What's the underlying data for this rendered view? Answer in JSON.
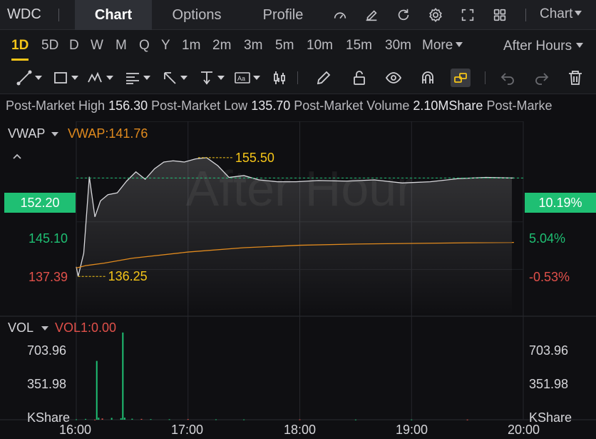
{
  "header": {
    "ticker": "WDC",
    "tabs": [
      "Chart",
      "Options",
      "Profile"
    ],
    "active_tab": "Chart",
    "icons": [
      "speedometer-icon",
      "edit-icon",
      "refresh-icon",
      "gear-icon",
      "fullscreen-icon",
      "grid-icon"
    ],
    "chart_menu": "Chart"
  },
  "timeframes": {
    "items": [
      "1D",
      "5D",
      "D",
      "W",
      "M",
      "Q",
      "Y",
      "1m",
      "2m",
      "3m",
      "5m",
      "10m",
      "15m",
      "30m",
      "More"
    ],
    "active": "1D",
    "session": "After Hours"
  },
  "draw_tools": [
    "line-tool-icon",
    "rectangle-tool-icon",
    "pattern-tool-icon",
    "fib-tool-icon",
    "arrow-tool-icon",
    "price-range-icon",
    "text-tool-icon",
    "candle-tool-icon",
    "pencil-icon",
    "unlock-icon",
    "eye-icon",
    "magnet-icon",
    "link-icon",
    "undo-icon",
    "redo-icon",
    "trash-icon"
  ],
  "info_strip": {
    "items": [
      {
        "label": "Post-Market High",
        "value": "156.30"
      },
      {
        "label": "Post-Market Low",
        "value": "135.70"
      },
      {
        "label": "Post-Market Volume",
        "value": "2.10MShare"
      },
      {
        "label": "Post-Marke",
        "value": ""
      }
    ]
  },
  "indicators": {
    "main": "VWAP",
    "vwap_value": "VWAP:141.76",
    "volume": "VOL",
    "vol_value": "VOL1:0.00"
  },
  "watermark": "After Hour",
  "colors": {
    "green": "#1fbf73",
    "red": "#e0504a",
    "vwap": "#e08a1e",
    "price_line": "#d8d8dc",
    "annotation": "#f5c518"
  },
  "chart_data": {
    "type": "line",
    "x_ticks": [
      "16:00",
      "17:00",
      "18:00",
      "19:00",
      "20:00"
    ],
    "price_axis_left": [
      "152.20",
      "145.10",
      "137.39"
    ],
    "price_axis_right": [
      "10.19%",
      "5.04%",
      "-0.53%"
    ],
    "current_price": "152.20",
    "current_pct": "10.19%",
    "high_marker": "155.50",
    "low_marker": "136.25",
    "volume_axis_left": [
      "703.96",
      "351.98",
      "KShare"
    ],
    "volume_axis_right": [
      "703.96",
      "351.98",
      "KShare"
    ],
    "price_series": [
      {
        "t": "16:00",
        "v": 137.8
      },
      {
        "t": "16:01",
        "v": 136.25
      },
      {
        "t": "16:04",
        "v": 140.0
      },
      {
        "t": "16:07",
        "v": 152.4
      },
      {
        "t": "16:10",
        "v": 145.9
      },
      {
        "t": "16:13",
        "v": 148.5
      },
      {
        "t": "16:17",
        "v": 149.5
      },
      {
        "t": "16:22",
        "v": 149.8
      },
      {
        "t": "16:27",
        "v": 151.7
      },
      {
        "t": "16:32",
        "v": 153.2
      },
      {
        "t": "16:37",
        "v": 152.0
      },
      {
        "t": "16:42",
        "v": 153.7
      },
      {
        "t": "16:47",
        "v": 154.8
      },
      {
        "t": "16:52",
        "v": 155.0
      },
      {
        "t": "16:58",
        "v": 154.8
      },
      {
        "t": "17:04",
        "v": 155.3
      },
      {
        "t": "17:10",
        "v": 155.5
      },
      {
        "t": "17:16",
        "v": 154.2
      },
      {
        "t": "17:22",
        "v": 152.3
      },
      {
        "t": "17:30",
        "v": 152.6
      },
      {
        "t": "17:38",
        "v": 151.9
      },
      {
        "t": "17:48",
        "v": 151.6
      },
      {
        "t": "17:58",
        "v": 151.6
      },
      {
        "t": "18:10",
        "v": 151.8
      },
      {
        "t": "18:25",
        "v": 151.7
      },
      {
        "t": "18:40",
        "v": 151.9
      },
      {
        "t": "18:55",
        "v": 151.4
      },
      {
        "t": "19:10",
        "v": 151.6
      },
      {
        "t": "19:25",
        "v": 152.1
      },
      {
        "t": "19:40",
        "v": 152.3
      },
      {
        "t": "19:55",
        "v": 152.2
      }
    ],
    "vwap_series": [
      {
        "t": "16:00",
        "v": 137.6
      },
      {
        "t": "16:05",
        "v": 138.0
      },
      {
        "t": "16:15",
        "v": 138.4
      },
      {
        "t": "16:30",
        "v": 139.2
      },
      {
        "t": "17:00",
        "v": 140.2
      },
      {
        "t": "17:30",
        "v": 140.9
      },
      {
        "t": "18:00",
        "v": 141.3
      },
      {
        "t": "18:30",
        "v": 141.5
      },
      {
        "t": "19:00",
        "v": 141.6
      },
      {
        "t": "19:30",
        "v": 141.7
      },
      {
        "t": "19:55",
        "v": 141.76
      }
    ],
    "volume_series": [
      {
        "t": "16:00",
        "v": 4
      },
      {
        "t": "16:05",
        "v": 8
      },
      {
        "t": "16:10",
        "v": 2
      },
      {
        "t": "16:11",
        "v": 580
      },
      {
        "t": "16:12",
        "v": 20
      },
      {
        "t": "16:14",
        "v": 12
      },
      {
        "t": "16:19",
        "v": 18
      },
      {
        "t": "16:24",
        "v": 15
      },
      {
        "t": "16:25",
        "v": 860
      },
      {
        "t": "16:26",
        "v": 20
      },
      {
        "t": "16:30",
        "v": 10
      },
      {
        "t": "16:35",
        "v": 8
      },
      {
        "t": "16:40",
        "v": 6
      },
      {
        "t": "16:50",
        "v": 5
      },
      {
        "t": "17:00",
        "v": 6
      },
      {
        "t": "17:15",
        "v": 4
      },
      {
        "t": "17:30",
        "v": 3
      },
      {
        "t": "18:00",
        "v": 3
      },
      {
        "t": "18:30",
        "v": 2
      },
      {
        "t": "19:00",
        "v": 2
      },
      {
        "t": "19:30",
        "v": 2
      }
    ],
    "volume_ylim": [
      0,
      880
    ],
    "price_ylim": [
      135.0,
      158.5
    ],
    "grid": true
  }
}
